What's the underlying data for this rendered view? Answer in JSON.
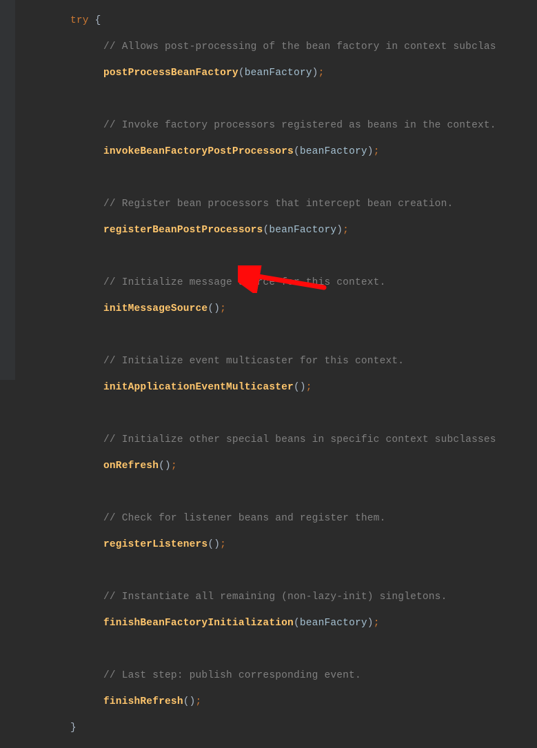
{
  "colors": {
    "bg": "#2b2b2b",
    "gutter": "#313335",
    "keyword": "#cc7832",
    "function": "#ffc66d",
    "identifier": "#a5c1d2",
    "comment": "#808080",
    "arrow": "#ff0a0a"
  },
  "code": {
    "tryKw": "try",
    "openBrace": " {",
    "closeBrace": "}",
    "cm1": "// Allows post-processing of the bean factory in context subclas",
    "fn1": "postProcessBeanFactory",
    "arg1": "beanFactory",
    "cm2": "// Invoke factory processors registered as beans in the context.",
    "fn2": "invokeBeanFactoryPostProcessors",
    "arg2": "beanFactory",
    "cm3": "// Register bean processors that intercept bean creation.",
    "fn3": "registerBeanPostProcessors",
    "arg3": "beanFactory",
    "cm4": "// Initialize message source for this context.",
    "fn4": "initMessageSource",
    "cm5": "// Initialize event multicaster for this context.",
    "fn5": "initApplicationEventMulticaster",
    "cm6": "// Initialize other special beans in specific context subclasses",
    "fn6": "onRefresh",
    "cm7": "// Check for listener beans and register them.",
    "fn7": "registerListeners",
    "cm8": "// Instantiate all remaining (non-lazy-init) singletons.",
    "fn8": "finishBeanFactoryInitialization",
    "arg8": "beanFactory",
    "cm9": "// Last step: publish corresponding event.",
    "fn9": "finishRefresh"
  },
  "arrow": {
    "name": "red-arrow-annotation"
  }
}
